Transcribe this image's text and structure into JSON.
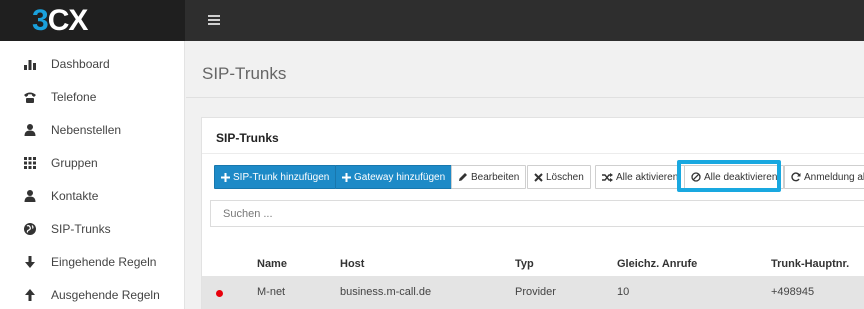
{
  "logo": {
    "part1": "3",
    "part2": "CX"
  },
  "sidebar": {
    "items": [
      {
        "label": "Dashboard",
        "icon": "bar-chart-icon"
      },
      {
        "label": "Telefone",
        "icon": "phone-icon"
      },
      {
        "label": "Nebenstellen",
        "icon": "user-icon"
      },
      {
        "label": "Gruppen",
        "icon": "grid-icon"
      },
      {
        "label": "Kontakte",
        "icon": "user-icon"
      },
      {
        "label": "SIP-Trunks",
        "icon": "globe-icon"
      },
      {
        "label": "Eingehende Regeln",
        "icon": "arrow-down-icon"
      },
      {
        "label": "Ausgehende Regeln",
        "icon": "arrow-up-icon"
      }
    ]
  },
  "page": {
    "title": "SIP-Trunks"
  },
  "panel": {
    "title": "SIP-Trunks"
  },
  "toolbar": {
    "add_trunk": "SIP-Trunk hinzufügen",
    "add_gateway": "Gateway hinzufügen",
    "edit": "Bearbeiten",
    "delete": "Löschen",
    "activate_all": "Alle aktivieren",
    "deactivate_all": "Alle deaktivieren",
    "register": "Anmeldung akt"
  },
  "search": {
    "placeholder": "Suchen ..."
  },
  "table": {
    "columns": [
      "Name",
      "Host",
      "Typ",
      "Gleichz. Anrufe",
      "Trunk-Hauptnr."
    ],
    "rows": [
      {
        "status_color": "#e8000b",
        "name": "M-net",
        "host": "business.m-call.de",
        "type": "Provider",
        "calls": "10",
        "number": "+498945"
      }
    ]
  },
  "colors": {
    "accent": "#1d8ac7",
    "highlight": "#19a8e0",
    "topbar": "#2e2e2e",
    "status_red": "#e8000b"
  }
}
